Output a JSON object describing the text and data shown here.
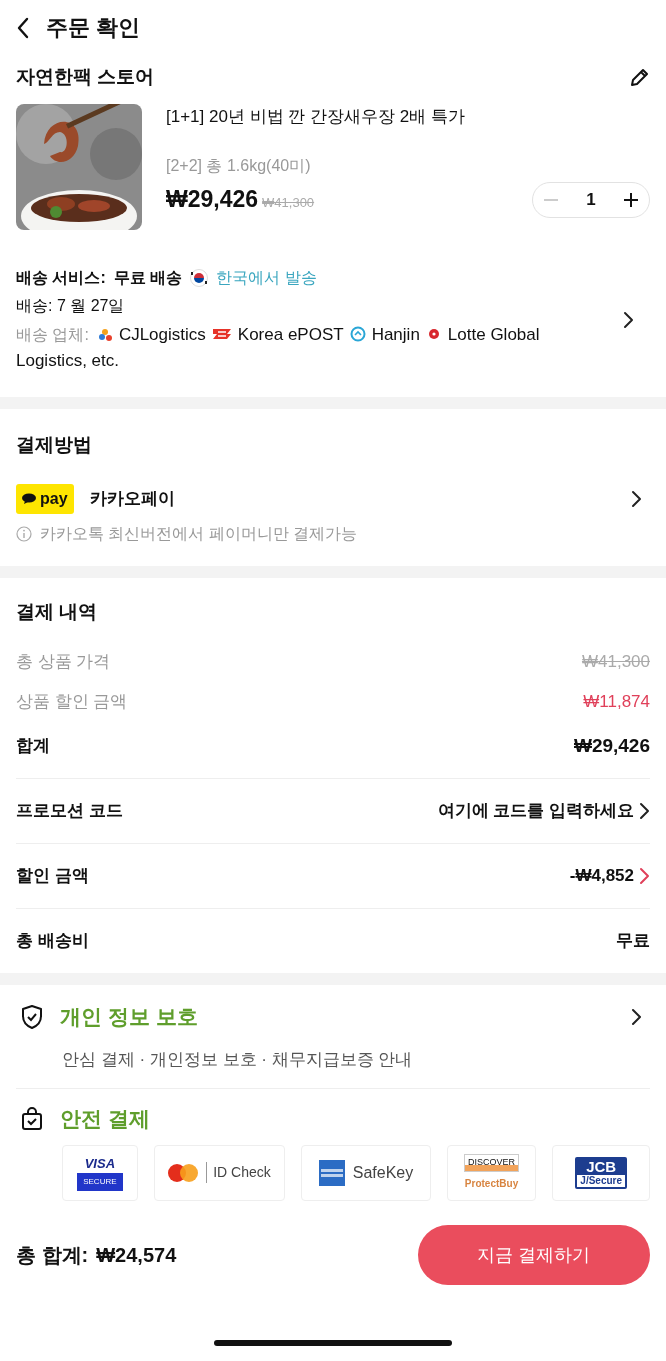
{
  "header": {
    "title": "주문 확인"
  },
  "store": {
    "name": "자연한팩 스토어"
  },
  "product": {
    "kind": "picture",
    "title": "[1+1] 20년 비법 깐 간장새우장 2배 특가",
    "option": "[2+2] 총 1.6kg(40미)",
    "price": "₩29,426",
    "original_price": "₩41,300",
    "quantity": "1",
    "decrement_disabled": true
  },
  "shipping": {
    "service_label": "배송 서비스:",
    "service": "무료 배송",
    "origin": "한국에서 발송",
    "delivery": "배송: 7 월 27일",
    "carriers_label": "배송 업체:",
    "carriers": [
      {
        "kind": "cj",
        "name": "CJLogistics"
      },
      {
        "kind": "epost",
        "name": "Korea ePOST"
      },
      {
        "kind": "hanjin",
        "name": "Hanjin"
      },
      {
        "kind": "lotte",
        "name": "Lotte Global"
      }
    ],
    "carriers_more": "Logistics, etc."
  },
  "payment_method": {
    "title": "결제방법",
    "badge": "pay",
    "name": "카카오페이",
    "notice": "카카오톡 최신버전에서 페이머니만 결제가능"
  },
  "summary": {
    "title": "결제 내역",
    "lines": [
      {
        "kind": "struck",
        "label": "총 상품 가격",
        "value": "₩41,300"
      },
      {
        "kind": "discount",
        "label": "상품 할인 금액",
        "value": "₩11,874"
      },
      {
        "kind": "total",
        "label": "합계",
        "value": "₩29,426"
      }
    ],
    "rows": [
      {
        "kind": "link",
        "label": "프로모션 코드",
        "value": "여기에 코드를 입력하세요"
      },
      {
        "kind": "discount_link",
        "label": "할인 금액",
        "value": "-₩4,852"
      },
      {
        "kind": "plain",
        "label": "총 배송비",
        "value": "무료"
      }
    ]
  },
  "privacy": {
    "title": "개인 정보 보호",
    "text": "안심 결제 · 개인정보 보호 · 채무지급보증 안내"
  },
  "secure": {
    "title": "안전 결제",
    "badges": [
      {
        "kind": "visa",
        "lines": [
          "VISA",
          "SECURE"
        ]
      },
      {
        "kind": "mastercard",
        "lines": [
          "ID Check"
        ]
      },
      {
        "kind": "amex",
        "lines": [
          "SafeKey"
        ]
      },
      {
        "kind": "discover",
        "lines": [
          "DISCOVER",
          "ProtectBuy"
        ]
      },
      {
        "kind": "jcb",
        "lines": [
          "JCB",
          "J/Secure"
        ]
      }
    ]
  },
  "footer": {
    "total_label": "총 합계:",
    "total": "₩24,574",
    "button": "지금 결제하기"
  }
}
